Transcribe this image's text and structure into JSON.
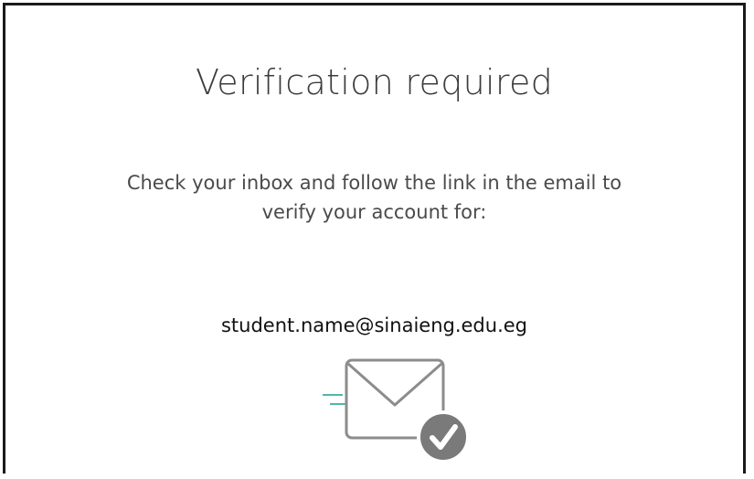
{
  "dialog": {
    "title": "Verification required",
    "message_line_1": "Check your inbox and follow the link in the email to",
    "message_line_2": "verify your account for:",
    "email": "student.name@sinaieng.edu.eg"
  },
  "illustration": {
    "icon": "envelope-check-icon",
    "envelope_stroke": "#8c8c8c",
    "motion_line_color": "#4fb8a8",
    "badge_color": "#7a7a7a"
  }
}
